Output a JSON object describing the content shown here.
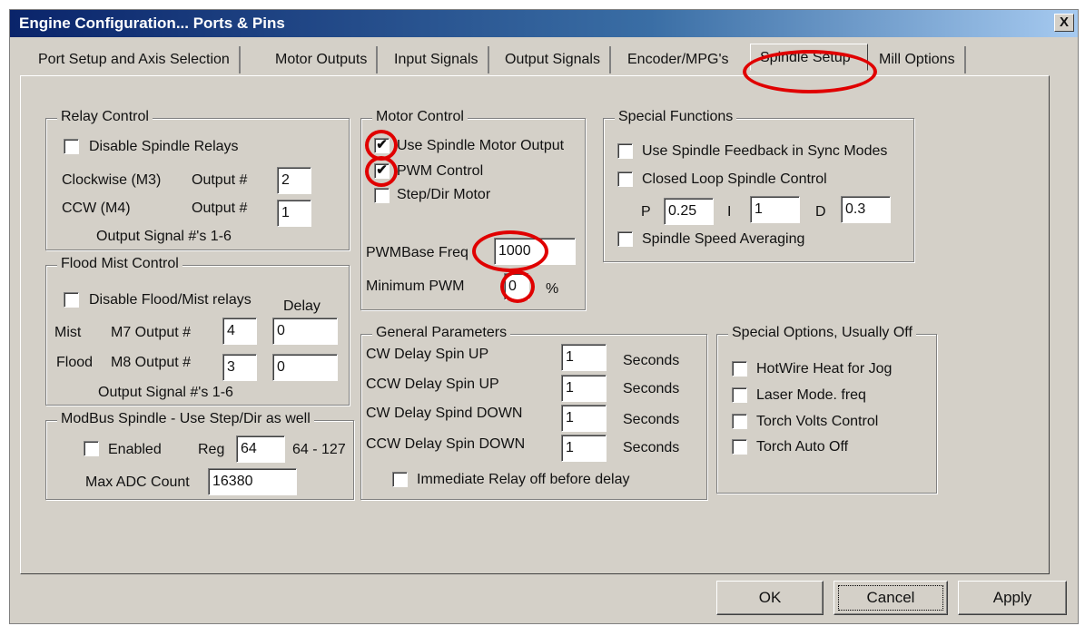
{
  "window": {
    "title": "Engine Configuration... Ports & Pins",
    "close_label": "X"
  },
  "tabs": [
    "Port Setup and Axis Selection",
    "Motor Outputs",
    "Input Signals",
    "Output Signals",
    "Encoder/MPG's",
    "Spindle Setup",
    "Mill Options"
  ],
  "relay_control": {
    "legend": "Relay Control",
    "disable_label": "Disable Spindle Relays",
    "cw_label": "Clockwise (M3)",
    "cw_output_label": "Output #",
    "cw_value": "2",
    "ccw_label": "CCW (M4)",
    "ccw_output_label": "Output #",
    "ccw_value": "1",
    "footer": "Output Signal #'s 1-6"
  },
  "flood_mist": {
    "legend": "Flood Mist Control",
    "disable_label": "Disable Flood/Mist relays",
    "delay_label": "Delay",
    "mist_label": "Mist",
    "mist_output_label": "M7 Output #",
    "mist_value": "4",
    "mist_delay": "0",
    "flood_label": "Flood",
    "flood_output_label": "M8 Output #",
    "flood_value": "3",
    "flood_delay": "0",
    "footer": "Output Signal #'s 1-6"
  },
  "modbus": {
    "legend": "ModBus Spindle - Use Step/Dir as well",
    "enabled_label": "Enabled",
    "reg_label": "Reg",
    "reg_value": "64",
    "reg_range": "64 - 127",
    "max_adc_label": "Max ADC Count",
    "max_adc_value": "16380"
  },
  "motor_control": {
    "legend": "Motor Control",
    "use_spindle_label": "Use Spindle Motor Output",
    "use_spindle_checked": "✔",
    "pwm_label": "PWM Control",
    "pwm_checked": "✔",
    "stepdir_label": "Step/Dir Motor",
    "pwm_base_label": "PWMBase Freq",
    "pwm_base_value": "1000",
    "min_pwm_label": "Minimum PWM",
    "min_pwm_value": "0",
    "min_pwm_unit": "%"
  },
  "general": {
    "legend": "General Parameters",
    "rows": [
      {
        "label": "CW Delay Spin UP",
        "value": "1",
        "unit": "Seconds"
      },
      {
        "label": "CCW Delay Spin UP",
        "value": "1",
        "unit": "Seconds"
      },
      {
        "label": "CW Delay Spind DOWN",
        "value": "1",
        "unit": "Seconds"
      },
      {
        "label": "CCW Delay Spin DOWN",
        "value": "1",
        "unit": "Seconds"
      }
    ],
    "immediate_label": "Immediate Relay off before delay"
  },
  "special_functions": {
    "legend": "Special Functions",
    "feedback_label": "Use Spindle Feedback in Sync Modes",
    "closed_loop_label": "Closed Loop Spindle Control",
    "p_label": "P",
    "p_value": "0.25",
    "i_label": "I",
    "i_value": "1",
    "d_label": "D",
    "d_value": "0.3",
    "averaging_label": "Spindle Speed Averaging"
  },
  "special_options": {
    "legend": "Special Options, Usually Off",
    "items": [
      "HotWire Heat for Jog",
      "Laser Mode. freq",
      "Torch Volts Control",
      "Torch Auto Off"
    ]
  },
  "buttons": {
    "ok": "OK",
    "cancel": "Cancel",
    "apply": "Apply"
  },
  "colors": {
    "dialog_bg": "#d4d0c8",
    "title_bar": "#0a246a",
    "highlight_circle": "#e00000"
  }
}
